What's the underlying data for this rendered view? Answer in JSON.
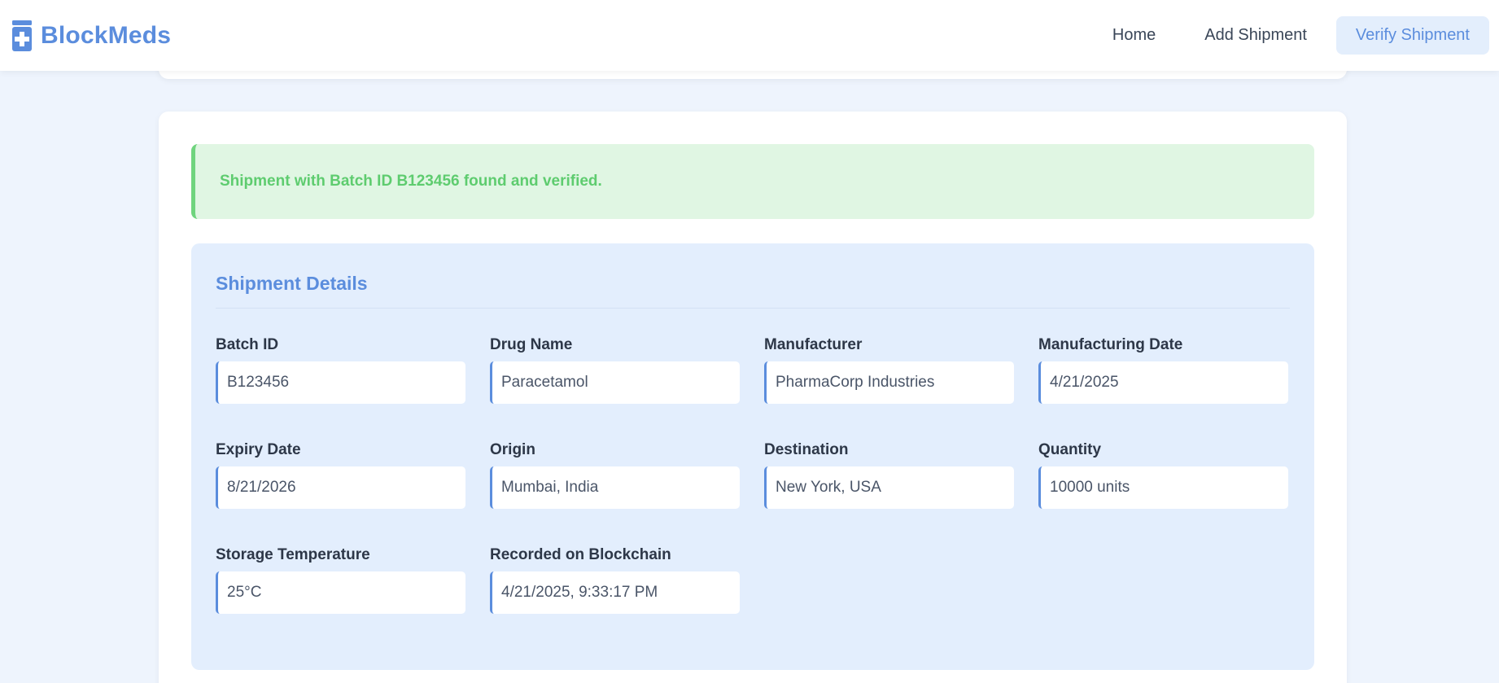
{
  "app": {
    "brand": "BlockMeds",
    "brand_icon": "medicine-bottle-icon",
    "accent_color": "#5b8ddd"
  },
  "nav": {
    "items": [
      {
        "label": "Home",
        "active": false
      },
      {
        "label": "Add Shipment",
        "active": false
      },
      {
        "label": "Verify Shipment",
        "active": true
      }
    ]
  },
  "alert": {
    "type": "success",
    "message": "Shipment with Batch ID B123456 found and verified.",
    "color": "#5ecc6f"
  },
  "details": {
    "title": "Shipment Details",
    "fields": [
      {
        "label": "Batch ID",
        "value": "B123456"
      },
      {
        "label": "Drug Name",
        "value": "Paracetamol"
      },
      {
        "label": "Manufacturer",
        "value": "PharmaCorp Industries"
      },
      {
        "label": "Manufacturing Date",
        "value": "4/21/2025"
      },
      {
        "label": "Expiry Date",
        "value": "8/21/2026"
      },
      {
        "label": "Origin",
        "value": "Mumbai, India"
      },
      {
        "label": "Destination",
        "value": "New York, USA"
      },
      {
        "label": "Quantity",
        "value": "10000 units"
      },
      {
        "label": "Storage Temperature",
        "value": "25°C"
      },
      {
        "label": "Recorded on Blockchain",
        "value": "4/21/2025, 9:33:17 PM"
      }
    ]
  }
}
